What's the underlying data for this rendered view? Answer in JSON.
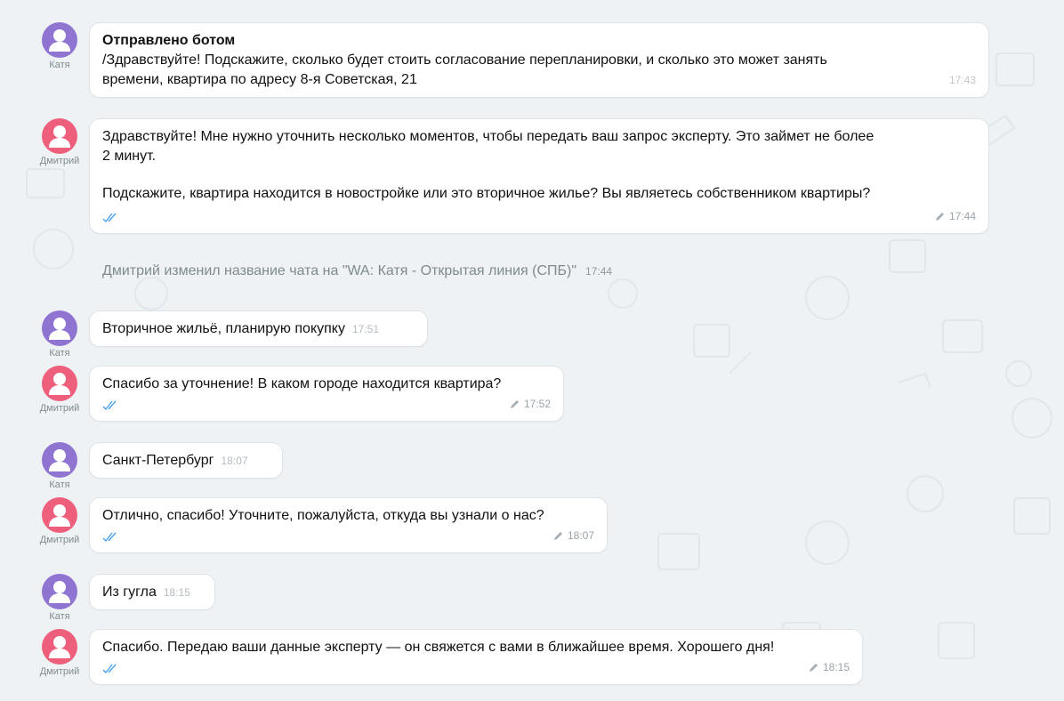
{
  "authors": {
    "katya": "Катя",
    "dmitry": "Дмитрий"
  },
  "messages": [
    {
      "author": "Катя",
      "header": "Отправлено ботом",
      "text1": "/Здравствуйте! Подскажите, сколько будет стоить согласование перепланировки, и сколько это может занять",
      "text2": "времени, квартира по адресу 8-я Советская, 21",
      "time": "17:43"
    },
    {
      "author": "Дмитрий",
      "text1": "Здравствуйте! Мне нужно уточнить несколько моментов, чтобы передать ваш запрос эксперту. Это займет не более",
      "text2": "2 минут.",
      "text3": "Подскажите, квартира находится в новостройке или это вторичное жилье? Вы являетесь собственником квартиры?",
      "time": "17:44"
    },
    {
      "author": "Катя",
      "text": "Вторичное жильё, планирую покупку",
      "time": "17:51"
    },
    {
      "author": "Дмитрий",
      "text": "Спасибо за уточнение! В каком городе находится квартира?",
      "time": "17:52"
    },
    {
      "author": "Катя",
      "text": "Санкт-Петербург",
      "time": "18:07"
    },
    {
      "author": "Дмитрий",
      "text": "Отлично, спасибо! Уточните, пожалуйста, откуда вы узнали о нас?",
      "time": "18:07"
    },
    {
      "author": "Катя",
      "text": "Из гугла",
      "time": "18:15"
    },
    {
      "author": "Дмитрий",
      "text": "Спасибо. Передаю ваши данные эксперту — он свяжется с вами в ближайшее время. Хорошего дня!",
      "time": "18:15"
    }
  ],
  "system_message": {
    "text": "Дмитрий изменил название чата на \"WA: Катя - Открытая линия (СПБ)\"",
    "time": "17:44"
  },
  "colors": {
    "background": "#eef2f4",
    "avatar_katya": "#8f74d2",
    "avatar_dmitry": "#ee5f7c",
    "read_checks": "#4a9ee8"
  }
}
